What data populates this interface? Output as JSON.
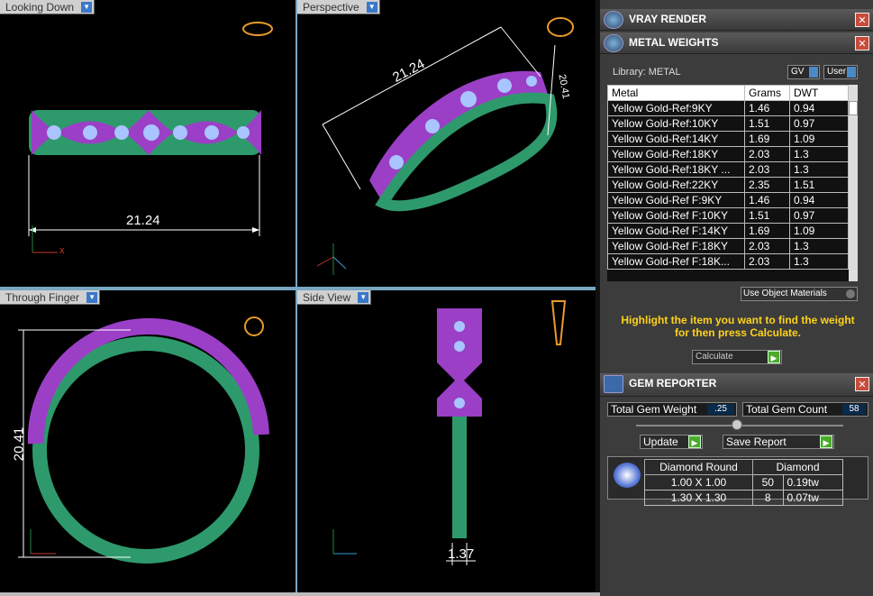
{
  "viewports": {
    "top_left": {
      "label": "Looking Down",
      "dimension": "21.24",
      "axes": [
        "y",
        "x"
      ]
    },
    "top_right": {
      "label": "Perspective",
      "dimension_long": "21.24",
      "dimension_short": "20.41",
      "axes": [
        "z",
        "x",
        "y"
      ]
    },
    "bottom_left": {
      "label": "Through Finger",
      "dimension": "20.41",
      "axes": [
        "z",
        "x"
      ]
    },
    "bottom_right": {
      "label": "Side View",
      "dimension": "1.37",
      "axes": [
        "z",
        "y"
      ]
    }
  },
  "panel": {
    "vray": {
      "title": "VRAY RENDER"
    },
    "metal": {
      "title": "METAL WEIGHTS",
      "library": "Library: METAL",
      "gv": "GV",
      "user": "User",
      "headers": [
        "Metal",
        "Grams",
        "DWT"
      ],
      "rows": [
        [
          "Yellow Gold-Ref:9KY",
          "1.46",
          "0.94"
        ],
        [
          "Yellow Gold-Ref:10KY",
          "1.51",
          "0.97"
        ],
        [
          "Yellow Gold-Ref:14KY",
          "1.69",
          "1.09"
        ],
        [
          "Yellow Gold-Ref:18KY",
          "2.03",
          "1.3"
        ],
        [
          "Yellow Gold-Ref:18KY ...",
          "2.03",
          "1.3"
        ],
        [
          "Yellow Gold-Ref:22KY",
          "2.35",
          "1.51"
        ],
        [
          "Yellow Gold-Ref F:9KY",
          "1.46",
          "0.94"
        ],
        [
          "Yellow Gold-Ref F:10KY",
          "1.51",
          "0.97"
        ],
        [
          "Yellow Gold-Ref F:14KY",
          "1.69",
          "1.09"
        ],
        [
          "Yellow Gold-Ref F:18KY",
          "2.03",
          "1.3"
        ],
        [
          "Yellow Gold-Ref F:18K...",
          "2.03",
          "1.3"
        ]
      ],
      "use_object_materials": "Use Object Materials",
      "hint": "Highlight the item you want to find the weight for then press Calculate.",
      "calculate": "Calculate"
    },
    "gem": {
      "title": "GEM REPORTER",
      "total_weight_label": "Total Gem Weight",
      "total_weight": ".25",
      "total_count_label": "Total Gem Count",
      "total_count": "58",
      "update": "Update",
      "save_report": "Save Report",
      "col1": "Diamond Round",
      "col2": "Diamond",
      "rows": [
        {
          "size": "1.00 X 1.00",
          "count": "50",
          "tw": "0.19tw"
        },
        {
          "size": "1.30 X 1.30",
          "count": "8",
          "tw": "0.07tw"
        }
      ]
    }
  },
  "colors": {
    "metal": "#2e9a6c",
    "gem": "#9b3fc6",
    "stone": "#a9c4ff",
    "accent_text": "#ffd21a"
  }
}
